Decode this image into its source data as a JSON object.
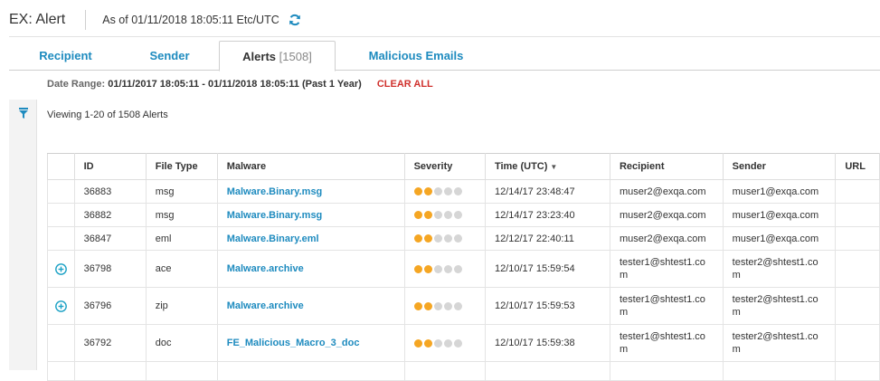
{
  "header": {
    "title": "EX: Alert",
    "as_of": "As of 01/11/2018 18:05:11 Etc/UTC",
    "refresh_icon": "refresh-icon"
  },
  "tabs": [
    {
      "label": "Recipient",
      "count": ""
    },
    {
      "label": "Sender",
      "count": ""
    },
    {
      "label": "Alerts",
      "count": "[1508]"
    },
    {
      "label": "Malicious Emails",
      "count": ""
    }
  ],
  "active_tab": "Alerts",
  "filter": {
    "date_range_label": "Date Range:",
    "date_range_value": "01/11/2017 18:05:11 - 01/11/2018 18:05:11 (Past 1 Year)",
    "clear_all": "CLEAR ALL",
    "icon": "funnel-icon"
  },
  "viewing": "Viewing 1-20 of 1508 Alerts",
  "colors": {
    "accent": "#1e8bbf",
    "danger": "#d0312d",
    "severity_on": "#f5a623",
    "severity_off": "#d6d6d6",
    "expand": "#1ba1c5"
  },
  "table": {
    "columns": [
      "",
      "ID",
      "File Type",
      "Malware",
      "Severity",
      "Time (UTC)",
      "Recipient",
      "Sender",
      "URL"
    ],
    "sorted_column_caret": "▼",
    "rows": [
      {
        "expand": false,
        "id": "36883",
        "file_type": "msg",
        "malware": "Malware.Binary.msg",
        "severity": 2,
        "time": "12/14/17 23:48:47",
        "recipient": "muser2@exqa.com",
        "sender": "muser1@exqa.com",
        "url": ""
      },
      {
        "expand": false,
        "id": "36882",
        "file_type": "msg",
        "malware": "Malware.Binary.msg",
        "severity": 2,
        "time": "12/14/17 23:23:40",
        "recipient": "muser2@exqa.com",
        "sender": "muser1@exqa.com",
        "url": ""
      },
      {
        "expand": false,
        "id": "36847",
        "file_type": "eml",
        "malware": "Malware.Binary.eml",
        "severity": 2,
        "time": "12/12/17 22:40:11",
        "recipient": "muser2@exqa.com",
        "sender": "muser1@exqa.com",
        "url": ""
      },
      {
        "expand": true,
        "id": "36798",
        "file_type": "ace",
        "malware": "Malware.archive",
        "severity": 2,
        "time": "12/10/17 15:59:54",
        "recipient": "tester1@shtest1.com",
        "sender": "tester2@shtest1.com",
        "url": ""
      },
      {
        "expand": true,
        "id": "36796",
        "file_type": "zip",
        "malware": "Malware.archive",
        "severity": 2,
        "time": "12/10/17 15:59:53",
        "recipient": "tester1@shtest1.com",
        "sender": "tester2@shtest1.com",
        "url": ""
      },
      {
        "expand": false,
        "id": "36792",
        "file_type": "doc",
        "malware": "FE_Malicious_Macro_3_doc",
        "severity": 2,
        "time": "12/10/17 15:59:38",
        "recipient": "tester1@shtest1.com",
        "sender": "tester2@shtest1.com",
        "url": ""
      }
    ],
    "severity_max": 5
  }
}
